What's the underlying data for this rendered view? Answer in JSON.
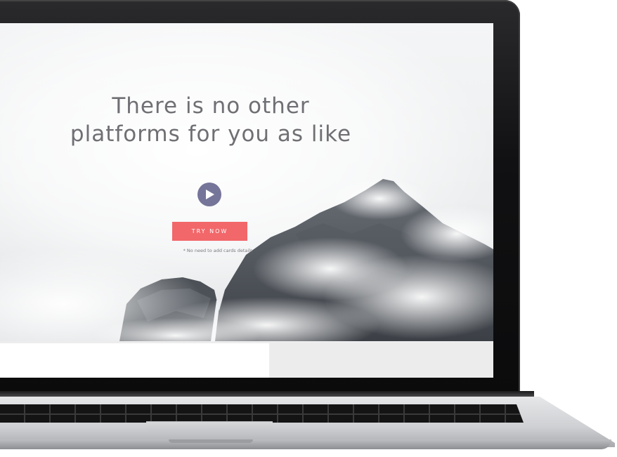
{
  "hero": {
    "headline_line1": "There is no other",
    "headline_line2": "platforms for you as like",
    "play_icon": "play-icon",
    "cta_label": "TRY NOW",
    "note": "* No need to add cards details"
  },
  "colors": {
    "cta_background": "#f2676a",
    "play_button": "#757599",
    "headline_text": "#6f6f74"
  }
}
